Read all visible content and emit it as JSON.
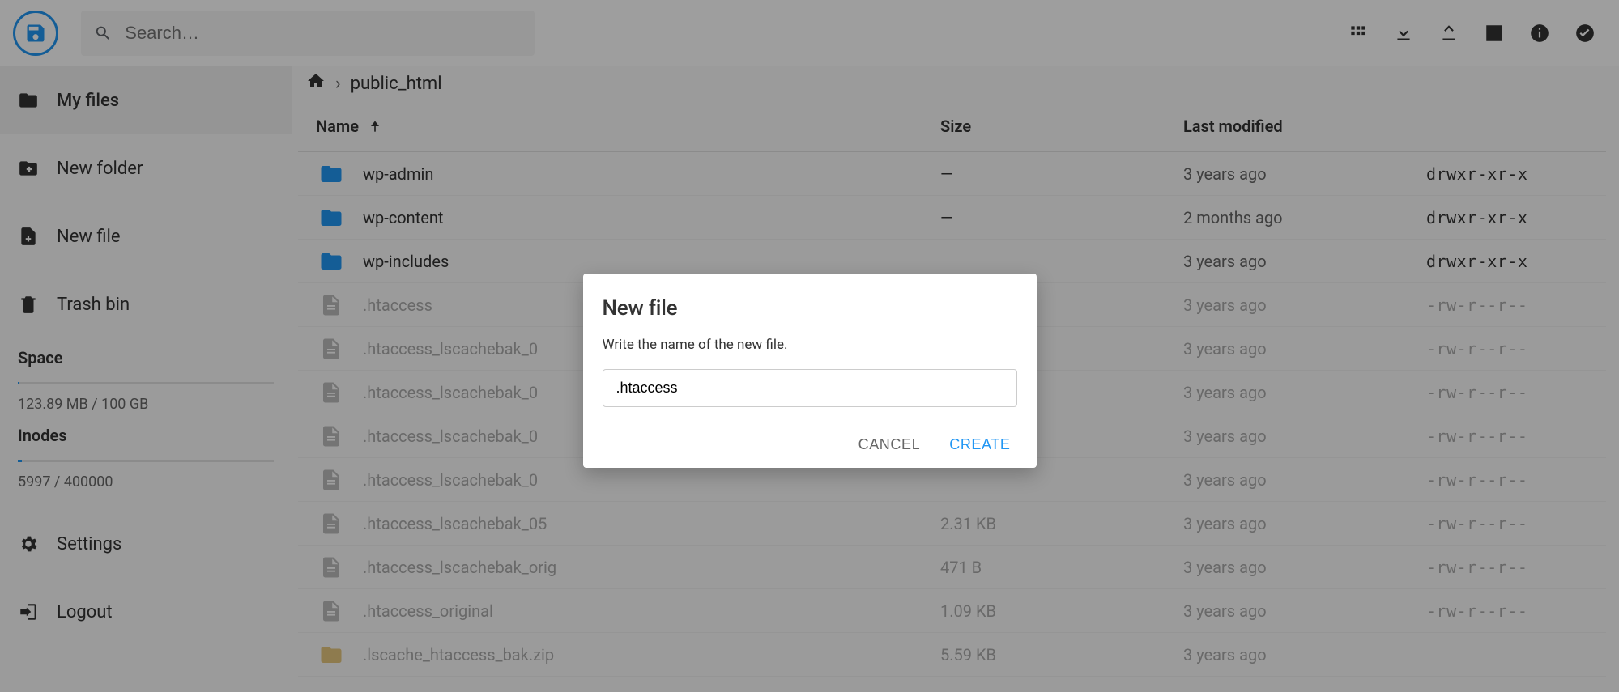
{
  "search": {
    "placeholder": "Search…"
  },
  "sidebar": {
    "items": [
      {
        "label": "My files"
      },
      {
        "label": "New folder"
      },
      {
        "label": "New file"
      },
      {
        "label": "Trash bin"
      }
    ],
    "space": {
      "title": "Space",
      "value": "123.89 MB / 100 GB",
      "fill_pct": 0.12
    },
    "inodes": {
      "title": "Inodes",
      "value": "5997 / 400000",
      "fill_pct": 1.5
    },
    "settings_label": "Settings",
    "logout_label": "Logout"
  },
  "breadcrumb": {
    "current": "public_html"
  },
  "columns": {
    "name": "Name",
    "size": "Size",
    "modified": "Last modified"
  },
  "rows": [
    {
      "type": "folder",
      "name": "wp-admin",
      "size": "—",
      "modified": "3 years ago",
      "perm": "drwxr-xr-x",
      "dimmed": false
    },
    {
      "type": "folder",
      "name": "wp-content",
      "size": "—",
      "modified": "2 months ago",
      "perm": "drwxr-xr-x",
      "dimmed": false
    },
    {
      "type": "folder",
      "name": "wp-includes",
      "size": "",
      "modified": "3 years ago",
      "perm": "drwxr-xr-x",
      "dimmed": false
    },
    {
      "type": "file",
      "name": ".htaccess",
      "size": "",
      "modified": "3 years ago",
      "perm": "-rw-r--r--",
      "dimmed": true
    },
    {
      "type": "file",
      "name": ".htaccess_lscachebak_0",
      "size": "",
      "modified": "3 years ago",
      "perm": "-rw-r--r--",
      "dimmed": true
    },
    {
      "type": "file",
      "name": ".htaccess_lscachebak_0",
      "size": "",
      "modified": "3 years ago",
      "perm": "-rw-r--r--",
      "dimmed": true
    },
    {
      "type": "file",
      "name": ".htaccess_lscachebak_0",
      "size": "",
      "modified": "3 years ago",
      "perm": "-rw-r--r--",
      "dimmed": true
    },
    {
      "type": "file",
      "name": ".htaccess_lscachebak_0",
      "size": "",
      "modified": "3 years ago",
      "perm": "-rw-r--r--",
      "dimmed": true
    },
    {
      "type": "file",
      "name": ".htaccess_lscachebak_05",
      "size": "2.31 KB",
      "modified": "3 years ago",
      "perm": "-rw-r--r--",
      "dimmed": true
    },
    {
      "type": "file",
      "name": ".htaccess_lscachebak_orig",
      "size": "471 B",
      "modified": "3 years ago",
      "perm": "-rw-r--r--",
      "dimmed": true
    },
    {
      "type": "file",
      "name": ".htaccess_original",
      "size": "1.09 KB",
      "modified": "3 years ago",
      "perm": "-rw-r--r--",
      "dimmed": true
    },
    {
      "type": "archive",
      "name": ".lscache_htaccess_bak.zip",
      "size": "5.59 KB",
      "modified": "3 years ago",
      "perm": "",
      "dimmed": true
    }
  ],
  "dialog": {
    "title": "New file",
    "prompt": "Write the name of the new file.",
    "value": ".htaccess",
    "cancel": "CANCEL",
    "create": "CREATE"
  }
}
